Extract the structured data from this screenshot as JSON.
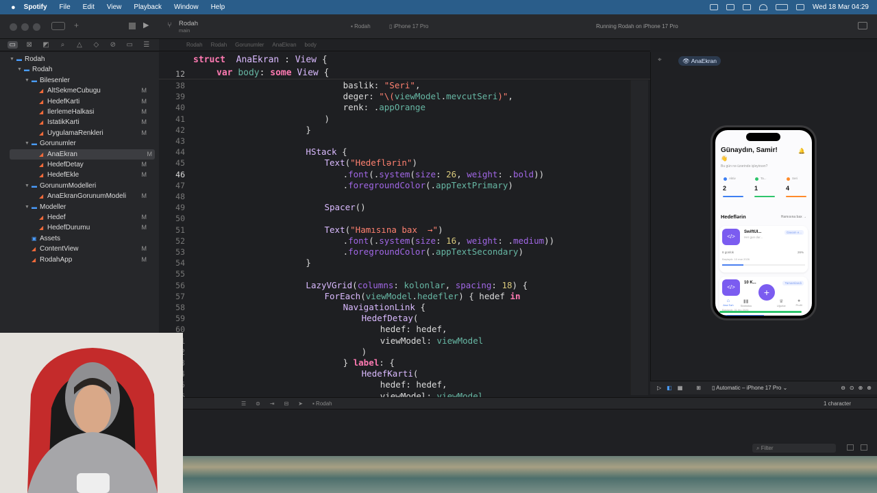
{
  "menubar": {
    "app": "Spotify",
    "items": [
      "File",
      "Edit",
      "View",
      "Playback",
      "Window",
      "Help"
    ],
    "clock": "Wed 18 Mar 04:29"
  },
  "toolbar": {
    "project": "Rodah",
    "branch": "main",
    "scheme": "Rodah",
    "device": "iPhone 17 Pro",
    "status": "Running Rodah on iPhone 17 Pro"
  },
  "jumpbar": [
    "Rodah",
    "Rodah",
    "Gorunumler",
    "AnaEkran",
    "body"
  ],
  "sidebar": {
    "items": [
      {
        "label": "Rodah",
        "level": 0,
        "kind": "project",
        "badge": "",
        "open": true
      },
      {
        "label": "Rodah",
        "level": 1,
        "kind": "folder",
        "badge": "",
        "open": true
      },
      {
        "label": "Bilesenler",
        "level": 2,
        "kind": "folder",
        "badge": "",
        "open": true
      },
      {
        "label": "AltSekmeCubugu",
        "level": 3,
        "kind": "file",
        "badge": "M"
      },
      {
        "label": "HedefKarti",
        "level": 3,
        "kind": "file",
        "badge": "M"
      },
      {
        "label": "IlerlemeHalkasi",
        "level": 3,
        "kind": "file",
        "badge": "M"
      },
      {
        "label": "IstatikKarti",
        "level": 3,
        "kind": "file",
        "badge": "M"
      },
      {
        "label": "UygulamaRenkleri",
        "level": 3,
        "kind": "file",
        "badge": "M"
      },
      {
        "label": "Gorunumler",
        "level": 2,
        "kind": "folder",
        "badge": "",
        "open": true
      },
      {
        "label": "AnaEkran",
        "level": 3,
        "kind": "file",
        "badge": "M",
        "selected": true
      },
      {
        "label": "HedefDetay",
        "level": 3,
        "kind": "file",
        "badge": "M"
      },
      {
        "label": "HedefEkle",
        "level": 3,
        "kind": "file",
        "badge": "M"
      },
      {
        "label": "GorunumModelleri",
        "level": 2,
        "kind": "folder",
        "badge": "",
        "open": true
      },
      {
        "label": "AnaEkranGorunumModeli",
        "level": 3,
        "kind": "file",
        "badge": "M"
      },
      {
        "label": "Modeller",
        "level": 2,
        "kind": "folder",
        "badge": "",
        "open": true
      },
      {
        "label": "Hedef",
        "level": 3,
        "kind": "file",
        "badge": "M"
      },
      {
        "label": "HedefDurumu",
        "level": 3,
        "kind": "file",
        "badge": "M"
      },
      {
        "label": "Assets",
        "level": 2,
        "kind": "asset",
        "badge": ""
      },
      {
        "label": "ContentView",
        "level": 2,
        "kind": "file",
        "badge": "M"
      },
      {
        "label": "RodahApp",
        "level": 2,
        "kind": "file",
        "badge": "M"
      }
    ]
  },
  "editor": {
    "sticky": [
      {
        "n": "",
        "t": [
          [
            "kw",
            "struct"
          ],
          [
            "",
            "  "
          ],
          [
            "ty",
            "AnaEkran"
          ],
          [
            "",
            " : "
          ],
          [
            "ty",
            "View"
          ],
          [
            "",
            " {"
          ]
        ],
        "x": 0
      },
      {
        "n": "12",
        "t": [
          [
            "kw",
            "var"
          ],
          [
            "",
            " "
          ],
          [
            "fn",
            "body"
          ],
          [
            "",
            ": "
          ],
          [
            "kw",
            "some"
          ],
          [
            "",
            " "
          ],
          [
            "ty",
            "View"
          ],
          [
            "",
            " {"
          ]
        ],
        "x": 1
      }
    ],
    "lines": [
      {
        "n": "38",
        "x": 8,
        "t": [
          [
            "",
            "baslik: "
          ],
          [
            "str",
            "\"Seri\""
          ],
          [
            "",
            ","
          ]
        ]
      },
      {
        "n": "39",
        "x": 8,
        "t": [
          [
            "",
            "deger: "
          ],
          [
            "str",
            "\"\\("
          ],
          [
            "fn",
            "viewModel"
          ],
          [
            "",
            "."
          ],
          [
            "fn",
            "mevcutSeri"
          ],
          [
            "str",
            ")\""
          ],
          [
            "",
            ","
          ]
        ]
      },
      {
        "n": "40",
        "x": 8,
        "t": [
          [
            "",
            "renk: ."
          ],
          [
            "fn",
            "appOrange"
          ]
        ]
      },
      {
        "n": "41",
        "x": 7,
        "t": [
          [
            "",
            ")"
          ]
        ]
      },
      {
        "n": "42",
        "x": 6,
        "t": [
          [
            "",
            "}"
          ]
        ]
      },
      {
        "n": "43",
        "x": 0,
        "t": []
      },
      {
        "n": "44",
        "x": 6,
        "t": [
          [
            "ty",
            "HStack"
          ],
          [
            "",
            " {"
          ]
        ]
      },
      {
        "n": "45",
        "x": 7,
        "t": [
          [
            "ty",
            "Text"
          ],
          [
            "",
            "("
          ],
          [
            "str",
            "\"Hedeflərin\""
          ],
          [
            "",
            ")"
          ]
        ]
      },
      {
        "n": "46",
        "x": 8,
        "t": [
          [
            "",
            "."
          ],
          [
            "pr",
            "font"
          ],
          [
            "",
            "(."
          ],
          [
            "pr",
            "system"
          ],
          [
            "",
            "("
          ],
          [
            "pr",
            "size"
          ],
          [
            "",
            ": "
          ],
          [
            "nm",
            "26"
          ],
          [
            "",
            ", "
          ],
          [
            "pr",
            "weight"
          ],
          [
            "",
            ": ."
          ],
          [
            "pr",
            "bold"
          ],
          [
            "",
            "))"
          ]
        ],
        "current": true
      },
      {
        "n": "47",
        "x": 8,
        "t": [
          [
            "",
            "."
          ],
          [
            "pr",
            "foregroundColor"
          ],
          [
            "",
            "(."
          ],
          [
            "fn",
            "appTextPrimary"
          ],
          [
            "",
            ")"
          ]
        ]
      },
      {
        "n": "48",
        "x": 0,
        "t": []
      },
      {
        "n": "49",
        "x": 7,
        "t": [
          [
            "ty",
            "Spacer"
          ],
          [
            "",
            "()"
          ]
        ]
      },
      {
        "n": "50",
        "x": 0,
        "t": []
      },
      {
        "n": "51",
        "x": 7,
        "t": [
          [
            "ty",
            "Text"
          ],
          [
            "",
            "("
          ],
          [
            "str",
            "\"Hamısına bax  →\""
          ],
          [
            "",
            ")"
          ]
        ]
      },
      {
        "n": "52",
        "x": 8,
        "t": [
          [
            "",
            "."
          ],
          [
            "pr",
            "font"
          ],
          [
            "",
            "(."
          ],
          [
            "pr",
            "system"
          ],
          [
            "",
            "("
          ],
          [
            "pr",
            "size"
          ],
          [
            "",
            ": "
          ],
          [
            "nm",
            "16"
          ],
          [
            "",
            ", "
          ],
          [
            "pr",
            "weight"
          ],
          [
            "",
            ": ."
          ],
          [
            "pr",
            "medium"
          ],
          [
            "",
            "))"
          ]
        ]
      },
      {
        "n": "53",
        "x": 8,
        "t": [
          [
            "",
            "."
          ],
          [
            "pr",
            "foregroundColor"
          ],
          [
            "",
            "(."
          ],
          [
            "fn",
            "appTextSecondary"
          ],
          [
            "",
            ")"
          ]
        ]
      },
      {
        "n": "54",
        "x": 6,
        "t": [
          [
            "",
            "}"
          ]
        ]
      },
      {
        "n": "55",
        "x": 0,
        "t": []
      },
      {
        "n": "56",
        "x": 6,
        "t": [
          [
            "ty",
            "LazyVGrid"
          ],
          [
            "",
            "("
          ],
          [
            "pr",
            "columns"
          ],
          [
            "",
            ": "
          ],
          [
            "fn",
            "kolonlar"
          ],
          [
            "",
            ", "
          ],
          [
            "pr",
            "spacing"
          ],
          [
            "",
            ": "
          ],
          [
            "nm",
            "18"
          ],
          [
            "",
            ") {"
          ]
        ]
      },
      {
        "n": "57",
        "x": 7,
        "t": [
          [
            "ty",
            "ForEach"
          ],
          [
            "",
            "("
          ],
          [
            "fn",
            "viewModel"
          ],
          [
            "",
            "."
          ],
          [
            "fn",
            "hedefler"
          ],
          [
            "",
            ") { hedef "
          ],
          [
            "kw",
            "in"
          ]
        ]
      },
      {
        "n": "58",
        "x": 8,
        "t": [
          [
            "ty",
            "NavigationLink"
          ],
          [
            "",
            " {"
          ]
        ]
      },
      {
        "n": "59",
        "x": 9,
        "t": [
          [
            "ty",
            "HedefDetay"
          ],
          [
            "",
            "("
          ]
        ]
      },
      {
        "n": "60",
        "x": 10,
        "t": [
          [
            "",
            "hedef: hedef,"
          ]
        ]
      },
      {
        "n": "61",
        "x": 10,
        "t": [
          [
            "",
            "viewModel: "
          ],
          [
            "fn",
            "viewModel"
          ]
        ]
      },
      {
        "n": "62",
        "x": 9,
        "t": [
          [
            "",
            ")"
          ]
        ]
      },
      {
        "n": "63",
        "x": 8,
        "t": [
          [
            "",
            "} "
          ],
          [
            "kw",
            "label"
          ],
          [
            "",
            ": {"
          ]
        ]
      },
      {
        "n": "64",
        "x": 9,
        "t": [
          [
            "ty",
            "HedefKarti"
          ],
          [
            "",
            "("
          ]
        ]
      },
      {
        "n": "65",
        "x": 10,
        "t": [
          [
            "",
            "hedef: hedef,"
          ]
        ]
      },
      {
        "n": "66",
        "x": 10,
        "t": [
          [
            "",
            "viewModel: "
          ],
          [
            "fn",
            "viewModel"
          ]
        ]
      }
    ],
    "gutter_numbers": [
      "38",
      "39",
      "40",
      "41",
      "42",
      "43",
      "44",
      "45",
      "46",
      "47",
      "48",
      "49",
      "50",
      "51",
      "52",
      "53",
      "54",
      "55",
      "56",
      "57",
      "58",
      "59",
      "60",
      "61",
      "62",
      "63",
      "64",
      "65",
      "66"
    ]
  },
  "canvas": {
    "preview_chip": "AnaEkran",
    "device_menu": "Automatic – iPhone 17 Pro",
    "phone": {
      "greeting": "Günaydın, Samir!",
      "wave": "👋",
      "subtitle": "Bu gün nə üzərində işləyirsən?",
      "stats": [
        {
          "label": "Aktiv",
          "value": "2",
          "color": "#3d7ff2"
        },
        {
          "label": "Ta...",
          "value": "1",
          "color": "#2ec46b"
        },
        {
          "label": "Seri",
          "value": "4",
          "color": "#ff8a2a"
        }
      ],
      "section_title": "Hedeflərin",
      "see_all": "Hamısına bax  →",
      "cards": [
        {
          "title": "SwiftUI...",
          "sub": "Her gun dur...",
          "tag": "Davam e...",
          "progress_label": "8 günlük",
          "percent": "26%",
          "start": "Başlayıb: 10 mar 2026",
          "progress": 0.26
        },
        {
          "title": "10 K...",
          "sub": "",
          "tag": "Tamamlandı",
          "progress_label": "",
          "percent": "",
          "start": "Başlayıb: 01 fev 2026",
          "progress": 0.5
        }
      ],
      "tabs": [
        "Ana Səh",
        "Statistika",
        "",
        "Uğurlar",
        "Profil"
      ]
    }
  },
  "status": {
    "scheme_small": "Rodah",
    "selection": "1 character",
    "filter": "Filter"
  },
  "colors": {
    "accent": "#7b5cf0",
    "menubar": "#2a5d8a"
  }
}
